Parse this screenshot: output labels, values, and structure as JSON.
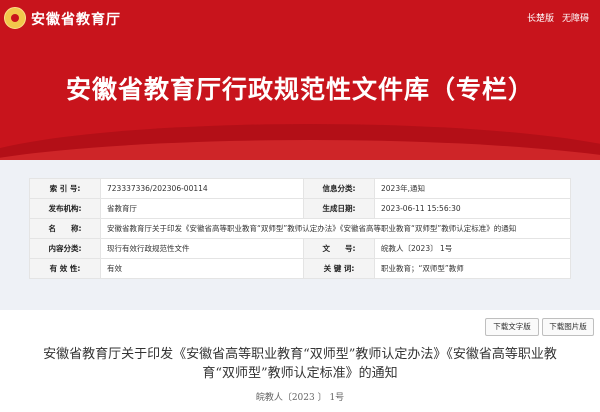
{
  "header": {
    "site_name": "安徽省教育厅",
    "links": [
      "长楚版",
      "无障碍"
    ],
    "brand_color": "#c8141c"
  },
  "hero": {
    "title": "安徽省教育厅行政规范性文件库（专栏）"
  },
  "meta": {
    "rows": [
      {
        "l1": "索 引 号:",
        "v1": "723337336/202306-00114",
        "l2": "信息分类:",
        "v2": "2023年,通知"
      },
      {
        "l1": "发布机构:",
        "v1": "省教育厅",
        "l2": "生成日期:",
        "v2": "2023-06-11 15:56:30"
      },
      {
        "l1": "名　　称:",
        "v1": "安徽省教育厅关于印发《安徽省高等职业教育“双师型”教师认定办法》《安徽省高等职业教育“双师型”教师认定标准》的通知"
      },
      {
        "l1": "内容分类:",
        "v1": "现行有效行政规范性文件",
        "l2": "文　　号:",
        "v2": "皖教人〔2023〕 1号"
      },
      {
        "l1": "有 效 性:",
        "v1": "有效",
        "l2": "关 键 词:",
        "v2": "职业教育；“双师型”教师"
      }
    ]
  },
  "buttons": {
    "download_text": "下载文字版",
    "download_image": "下载图片版"
  },
  "document": {
    "title": "安徽省教育厅关于印发《安徽省高等职业教育“双师型”教师认定办法》《安徽省高等职业教育“双师型”教师认定标准》的通知",
    "number": "皖教人〔2023 〕 1号"
  }
}
